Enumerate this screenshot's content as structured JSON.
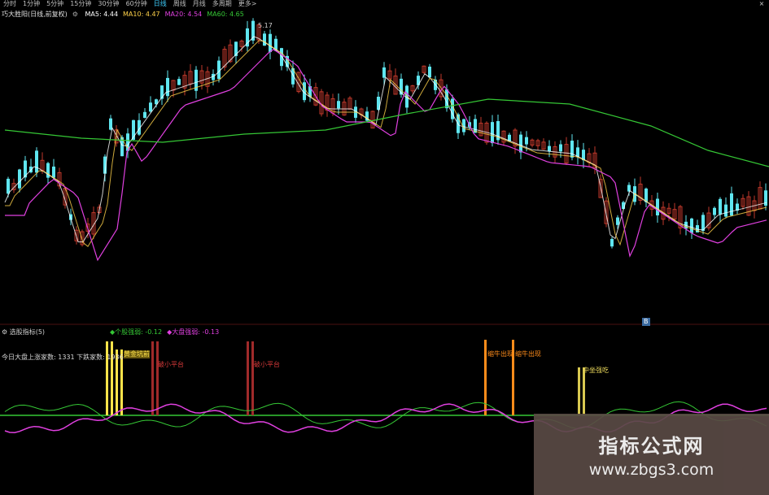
{
  "toolbar": {
    "periods": [
      "分时",
      "1分钟",
      "5分钟",
      "15分钟",
      "30分钟",
      "60分钟",
      "日线",
      "周线",
      "月线",
      "多周期",
      "更多>"
    ],
    "active_period": "日线",
    "close_label": "×"
  },
  "main_panel": {
    "title": "巧大胜阳(日线,前复权)",
    "ma": [
      {
        "label": "MA5: 4.44",
        "color": "#ffffff"
      },
      {
        "label": "MA10: 4.47",
        "color": "#ffd24a"
      },
      {
        "label": "MA20: 4.54",
        "color": "#e040e0"
      },
      {
        "label": "MA60: 4.65",
        "color": "#35c735"
      }
    ],
    "high_label": "5.17",
    "up_color": "#c0392b",
    "down_color": "#5fe6f0"
  },
  "sub_panel": {
    "title": "选股指标(5)",
    "legend": [
      {
        "label": "◆个股强弱: -0.12",
        "color": "#35c735"
      },
      {
        "label": "◆大盘强弱: -0.13",
        "color": "#e040e0"
      }
    ],
    "stats": "今日大盘上涨家数: 1331 下跌家数: 1936",
    "signals": [
      "黄金坑前",
      "破小平台",
      "破小平台",
      "缩牛出现",
      "缩牛出现",
      "中坐强吃"
    ],
    "marker": "B"
  },
  "watermark": {
    "title": "指标公式网",
    "url": "www.zbgs3.com"
  }
}
